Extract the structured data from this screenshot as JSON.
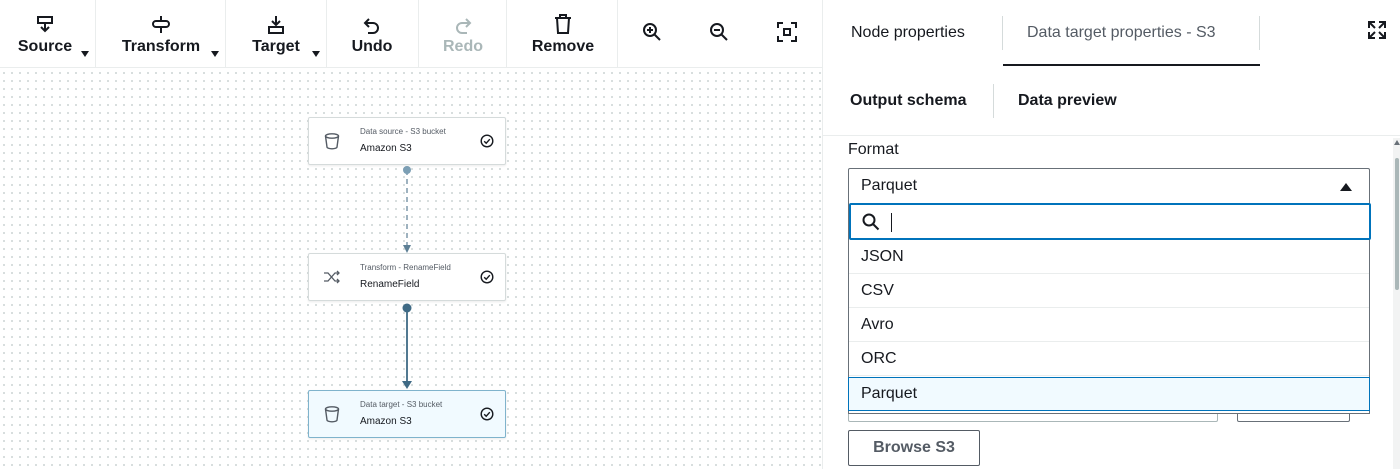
{
  "toolbar": {
    "source_label": "Source",
    "transform_label": "Transform",
    "target_label": "Target",
    "undo_label": "Undo",
    "redo_label": "Redo",
    "remove_label": "Remove",
    "icons": [
      "source-icon",
      "transform-icon",
      "target-icon",
      "undo-icon",
      "redo-icon",
      "trash-icon",
      "zoom-in-icon",
      "zoom-out-icon",
      "fit-to-screen-icon"
    ]
  },
  "canvas": {
    "nodes": [
      {
        "subtitle": "Data source - S3 bucket",
        "title": "Amazon S3",
        "icon": "bucket-icon",
        "status": "check-circle-icon",
        "selected": false
      },
      {
        "subtitle": "Transform - RenameField",
        "title": "RenameField",
        "icon": "shuffle-icon",
        "status": "check-circle-icon",
        "selected": false
      },
      {
        "subtitle": "Data target - S3 bucket",
        "title": "Amazon S3",
        "icon": "bucket-icon",
        "status": "check-circle-icon",
        "selected": true
      }
    ]
  },
  "panel": {
    "tabs": [
      {
        "label": "Node properties",
        "active": false
      },
      {
        "label": "Data target properties - S3",
        "active": true
      }
    ],
    "subtabs": [
      {
        "label": "Output schema"
      },
      {
        "label": "Data preview"
      }
    ],
    "format": {
      "label": "Format",
      "selected": "Parquet",
      "search_value": "",
      "options": [
        "JSON",
        "CSV",
        "Avro",
        "ORC",
        "Parquet"
      ]
    },
    "browse_label": "Browse S3"
  },
  "colors": {
    "accent": "#0073bb",
    "selected_bg": "#f1faff",
    "text": "#16191f",
    "disabled": "#aab7b8"
  }
}
